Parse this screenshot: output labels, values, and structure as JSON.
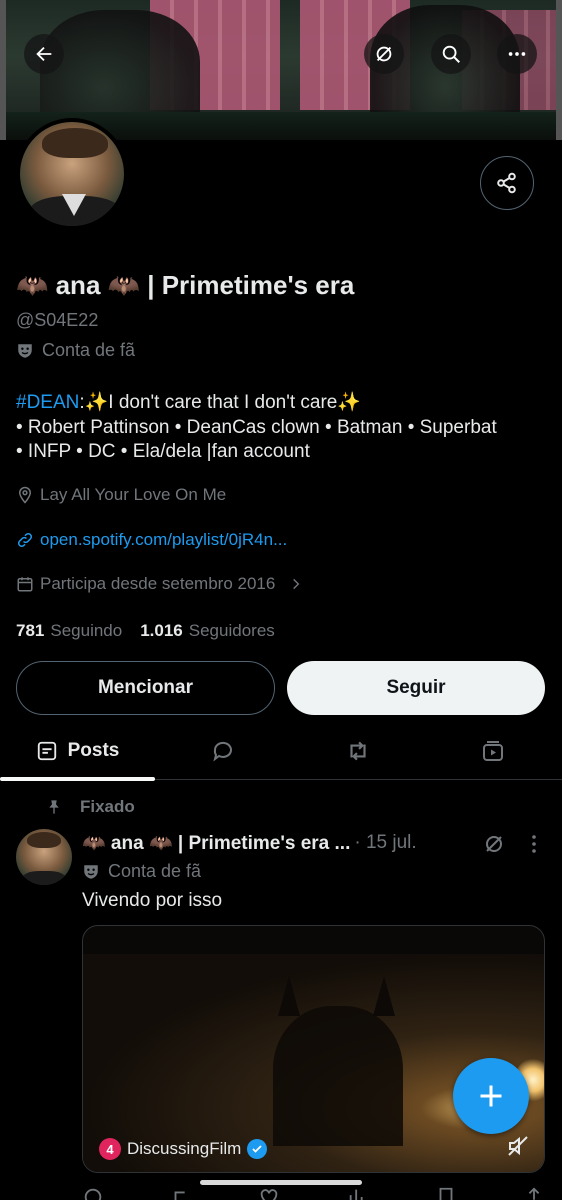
{
  "banner": {
    "alt_icons": [
      "back-arrow-icon",
      "grok-icon",
      "search-icon",
      "more-icon"
    ]
  },
  "profile": {
    "display_name": "🦇 ana 🦇 | Primetime's era",
    "handle": "@S04E22",
    "category": "Conta de fã",
    "bio_hashtag": "#DEAN",
    "bio_line1_rest": ":✨I don't care that I don't care✨",
    "bio_line2": "• Robert Pattinson • DeanCas clown • Batman • Superbat",
    "bio_line3": "• INFP • DC • Ela/dela |fan account",
    "location": "Lay All Your Love On Me",
    "link": "open.spotify.com/playlist/0jR4n...",
    "joined": "Participa desde setembro 2016",
    "following_count": "781",
    "following_label": "Seguindo",
    "followers_count": "1.016",
    "followers_label": "Seguidores"
  },
  "actions": {
    "mention_label": "Mencionar",
    "follow_label": "Seguir"
  },
  "tabs": [
    {
      "label": "Posts",
      "icon": "posts-icon",
      "active": true
    },
    {
      "label": "",
      "icon": "replies-icon"
    },
    {
      "label": "",
      "icon": "retweet-icon"
    },
    {
      "label": "",
      "icon": "media-icon"
    }
  ],
  "pinned_post": {
    "pinned_label": "Fixado",
    "author": "🦇 ana 🦇 | Primetime's era ...",
    "date": "· 15 jul.",
    "category": "Conta de fã",
    "text": "Vivendo por isso",
    "media_source": "DiscussingFilm",
    "media_source_logo": "4"
  },
  "colors": {
    "accent": "#1d9bf0",
    "background": "#000000",
    "muted": "#71767b",
    "text": "#e7e9ea"
  }
}
